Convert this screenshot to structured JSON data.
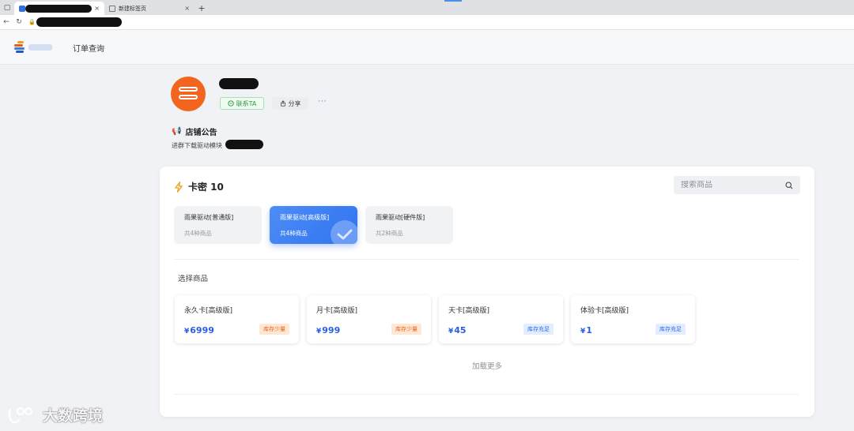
{
  "browser": {
    "tabs": [
      {
        "title": "",
        "active": true
      },
      {
        "title": "新建标签页",
        "active": false
      }
    ],
    "new_tab_symbol": "+",
    "close_symbol": "×"
  },
  "header": {
    "nav_order_query": "订单查询"
  },
  "shop": {
    "contact_label": "联系TA",
    "share_label": "分享",
    "more_label": "···",
    "notice_title": "店铺公告",
    "notice_text": "进群下载驱动模块"
  },
  "main": {
    "section_title": "卡密 10",
    "search_placeholder": "搜索商品",
    "categories": [
      {
        "name": "雨果驱动[普通版]",
        "count": "共4种商品",
        "active": false
      },
      {
        "name": "雨果驱动[高级版]",
        "count": "共4种商品",
        "active": true
      },
      {
        "name": "雨果驱动[硬件版]",
        "count": "共2种商品",
        "active": false
      }
    ],
    "select_label": "选择商品",
    "products": [
      {
        "name": "永久卡[高级版]",
        "currency": "¥",
        "price": "6999",
        "stock": "库存少量",
        "stock_level": "low"
      },
      {
        "name": "月卡[高级版]",
        "currency": "¥",
        "price": "999",
        "stock": "库存少量",
        "stock_level": "low"
      },
      {
        "name": "天卡[高级版]",
        "currency": "¥",
        "price": "45",
        "stock": "库存充足",
        "stock_level": "ok"
      },
      {
        "name": "体验卡[高级版]",
        "currency": "¥",
        "price": "1",
        "stock": "库存充足",
        "stock_level": "ok"
      }
    ],
    "load_more": "加载更多"
  },
  "watermark": {
    "text": "大数跨境"
  },
  "colors": {
    "accent": "#2f73f0",
    "shop_avatar": "#f2651e",
    "stock_low": "#e8651c",
    "stock_ok": "#2b6cf0",
    "contact_green": "#2c9a46"
  }
}
